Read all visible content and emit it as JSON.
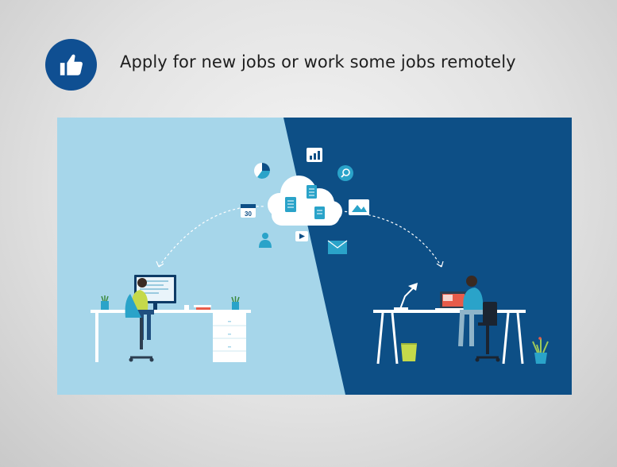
{
  "slide": {
    "headline": "Apply for new jobs or work some jobs remotely",
    "badge_icon": "thumbs-up-icon",
    "colors": {
      "badge": "#0f4f92",
      "left_panel": "#a6d6ea",
      "right_panel": "#0d4f86",
      "accent_teal": "#2aa3c9"
    }
  },
  "illustration": {
    "calendar_day": "30",
    "left_person": "office-worker",
    "right_person": "remote-worker",
    "cloud_icons": [
      "pie-chart-icon",
      "bar-chart-icon",
      "search-icon",
      "calendar-icon",
      "image-icon",
      "user-icon",
      "video-icon",
      "mail-icon",
      "document-icon"
    ]
  }
}
